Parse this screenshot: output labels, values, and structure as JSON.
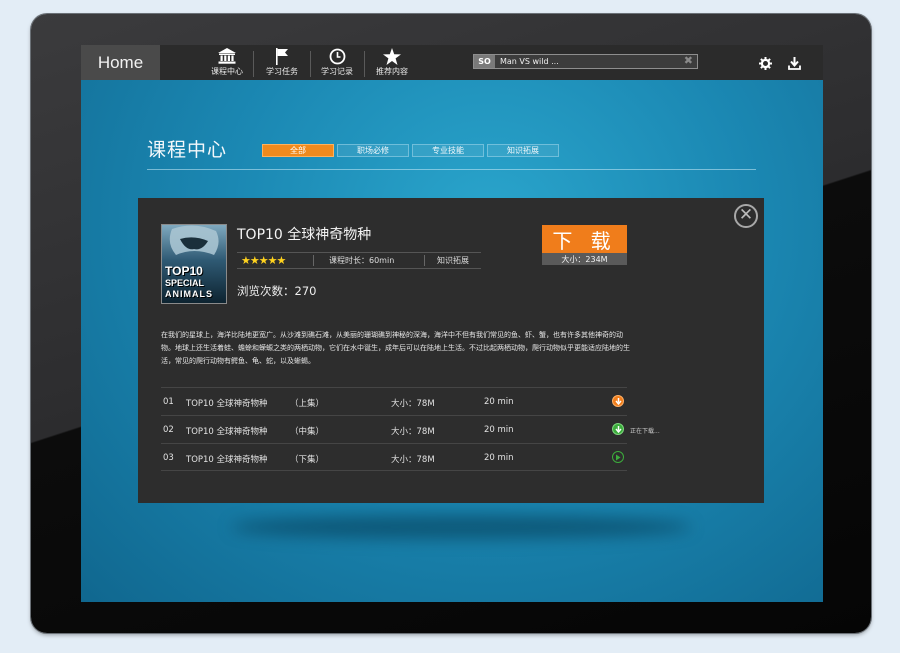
{
  "topbar": {
    "home_label": "Home",
    "nav": [
      {
        "label": "课程中心",
        "icon": "bank-icon"
      },
      {
        "label": "学习任务",
        "icon": "flag-icon"
      },
      {
        "label": "学习记录",
        "icon": "clock-icon"
      },
      {
        "label": "推荐内容",
        "icon": "star-icon"
      }
    ],
    "search": {
      "badge": "SO",
      "value": "Man VS wild ...",
      "clear_icon": "close-icon"
    },
    "tools": [
      {
        "icon": "gear-icon"
      },
      {
        "icon": "download-icon"
      }
    ]
  },
  "page": {
    "title": "课程中心",
    "categories": [
      {
        "label": "全部",
        "active": true
      },
      {
        "label": "职场必修",
        "active": false
      },
      {
        "label": "专业技能",
        "active": false
      },
      {
        "label": "知识拓展",
        "active": false
      }
    ]
  },
  "course": {
    "cover": {
      "line1": "TOP10",
      "line2": "SPECIAL",
      "line3": "ANIMALS"
    },
    "title": "TOP10 全球神奇物种",
    "stars": "★★★★★",
    "rating": 5,
    "duration": "课程时长：60min",
    "category": "知识拓展",
    "views": "浏览次数：270",
    "download_label": "下 载",
    "download_size": "大小：234M",
    "close_icon": "close-circle-icon",
    "description": "在我们的星球上，海洋比陆地更宽广。从沙滩到礁石滩，从美丽的珊瑚礁到神秘的深海，海洋中不但有我们常见的鱼、虾、蟹，也有许多其他神奇的动物。地球上还生活着蛙、蟾蜍和蝾螈之类的两栖动物，它们在水中诞生，成年后可以在陆地上生活。不过比起两栖动物，爬行动物似乎更能适应陆地的生活，常见的爬行动物有鳄鱼、龟、蛇，以及蜥蜴。",
    "episodes": [
      {
        "num": "01",
        "title": "TOP10 全球神奇物种",
        "part": "（上集）",
        "size": "大小：78M",
        "duration": "20 min",
        "action": "download",
        "color": "#f07d1b",
        "status": ""
      },
      {
        "num": "02",
        "title": "TOP10 全球神奇物种",
        "part": "（中集）",
        "size": "大小：78M",
        "duration": "20 min",
        "action": "downloading",
        "color": "#3cac3c",
        "status": "正在下载..."
      },
      {
        "num": "03",
        "title": "TOP10 全球神奇物种",
        "part": "（下集）",
        "size": "大小：78M",
        "duration": "20 min",
        "action": "play",
        "color": "#3cac3c",
        "status": ""
      }
    ]
  }
}
